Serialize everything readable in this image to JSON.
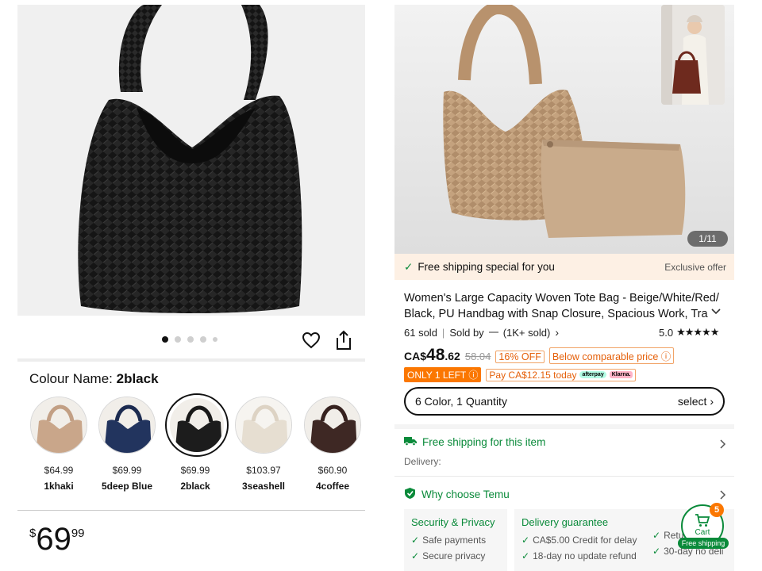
{
  "left": {
    "carousel": {
      "dot_count": 5,
      "active_index": 0
    },
    "colour": {
      "label": "Colour Name:",
      "value": "2black"
    },
    "swatches": [
      {
        "price": "$64.99",
        "name": "1khaki",
        "color": "#c8a58a"
      },
      {
        "price": "$69.99",
        "name": "5deep Blue",
        "color": "#22345e"
      },
      {
        "price": "$69.99",
        "name": "2black",
        "color": "#1c1c1c"
      },
      {
        "price": "$103.97",
        "name": "3seashell",
        "color": "#e6ded1"
      },
      {
        "price": "$60.90",
        "name": "4coffee",
        "color": "#3e2824"
      }
    ],
    "price": {
      "currency": "$",
      "whole": "69",
      "fraction": "99"
    }
  },
  "right": {
    "image_counter": "1/11",
    "banner": {
      "text": "Free shipping special for you",
      "right": "Exclusive offer"
    },
    "title": "Women's Large Capacity Woven Tote Bag - Beige/White/Red/ Black, PU Handbag with Snap Closure, Spacious Work, Tra",
    "sold": "61 sold",
    "sold_by": "Sold by",
    "seller_count": "(1K+ sold)",
    "rating": "5.0",
    "stars": "★★★★★",
    "price": {
      "currency": "CA$",
      "whole": "48",
      "fraction": ".62",
      "original": "58.04"
    },
    "discount": "16% OFF",
    "below_price": "Below comparable price",
    "only_left": "ONLY 1 LEFT",
    "pay_later": "Pay CA$12.15 today",
    "pill_afterpay": "afterpay",
    "pill_klarna": "Klarna.",
    "selector": {
      "label": "6 Color, 1 Quantity",
      "action": "select"
    },
    "free_ship_item": "Free shipping for this item",
    "delivery_label": "Delivery:",
    "why_choose": "Why choose Temu",
    "cards": [
      {
        "title": "Security & Privacy",
        "items": [
          "Safe payments",
          "Secure privacy"
        ]
      },
      {
        "title": "Delivery guarantee",
        "items": [
          "CA$5.00 Credit for delay",
          "18-day no update refund"
        ]
      },
      {
        "title": "",
        "items": [
          "Retu",
          "30-day no deli"
        ]
      }
    ],
    "cart": {
      "label": "Cart",
      "badge": "5",
      "ship": "Free shipping"
    },
    "colors": {
      "green": "#0a8a3a",
      "orange": "#fb7701"
    }
  }
}
